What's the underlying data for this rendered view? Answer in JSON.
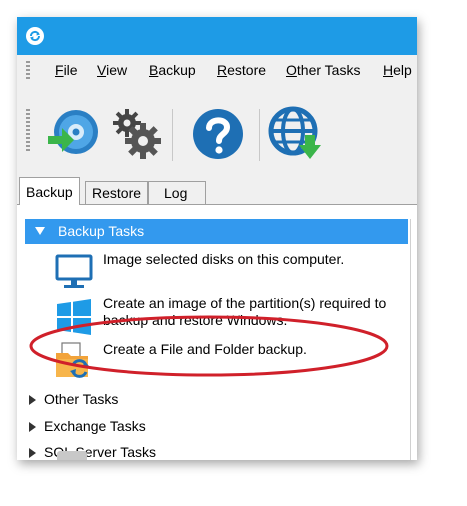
{
  "menu": {
    "items": [
      {
        "label": "File",
        "mnemonic": "F",
        "rest": "ile"
      },
      {
        "label": "View",
        "mnemonic": "V",
        "rest": "iew"
      },
      {
        "label": "Backup",
        "mnemonic": "B",
        "rest": "ackup"
      },
      {
        "label": "Restore",
        "mnemonic": "R",
        "rest": "estore"
      },
      {
        "label": "Other Tasks",
        "mnemonic": "O",
        "rest": "ther Tasks"
      },
      {
        "label": "Help",
        "mnemonic": "H",
        "rest": "elp"
      }
    ]
  },
  "toolbar": {
    "buttons": [
      {
        "icon": "backup-disc-icon"
      },
      {
        "icon": "settings-gears-icon"
      },
      {
        "icon": "help-icon"
      },
      {
        "icon": "globe-download-icon"
      }
    ]
  },
  "tabs": [
    {
      "label": "Backup",
      "active": true
    },
    {
      "label": "Restore",
      "active": false
    },
    {
      "label": "Log",
      "active": false
    }
  ],
  "groups": {
    "backup_tasks": {
      "label": "Backup Tasks",
      "items": [
        {
          "icon": "monitor-icon",
          "text": "Image selected disks on this computer."
        },
        {
          "icon": "windows-logo-icon",
          "text_line1": "Create an image of the partition(s) required to",
          "text_line2": "backup and restore Windows."
        },
        {
          "icon": "file-folder-backup-icon",
          "text": "Create a File and Folder backup."
        }
      ]
    },
    "collapsed": [
      {
        "label": "Other Tasks"
      },
      {
        "label": "Exchange Tasks"
      },
      {
        "label": "SQL Server Tasks"
      }
    ]
  },
  "colors": {
    "titlebar": "#1e9be6",
    "selection": "#3399ee",
    "annotation": "#d0202a"
  }
}
